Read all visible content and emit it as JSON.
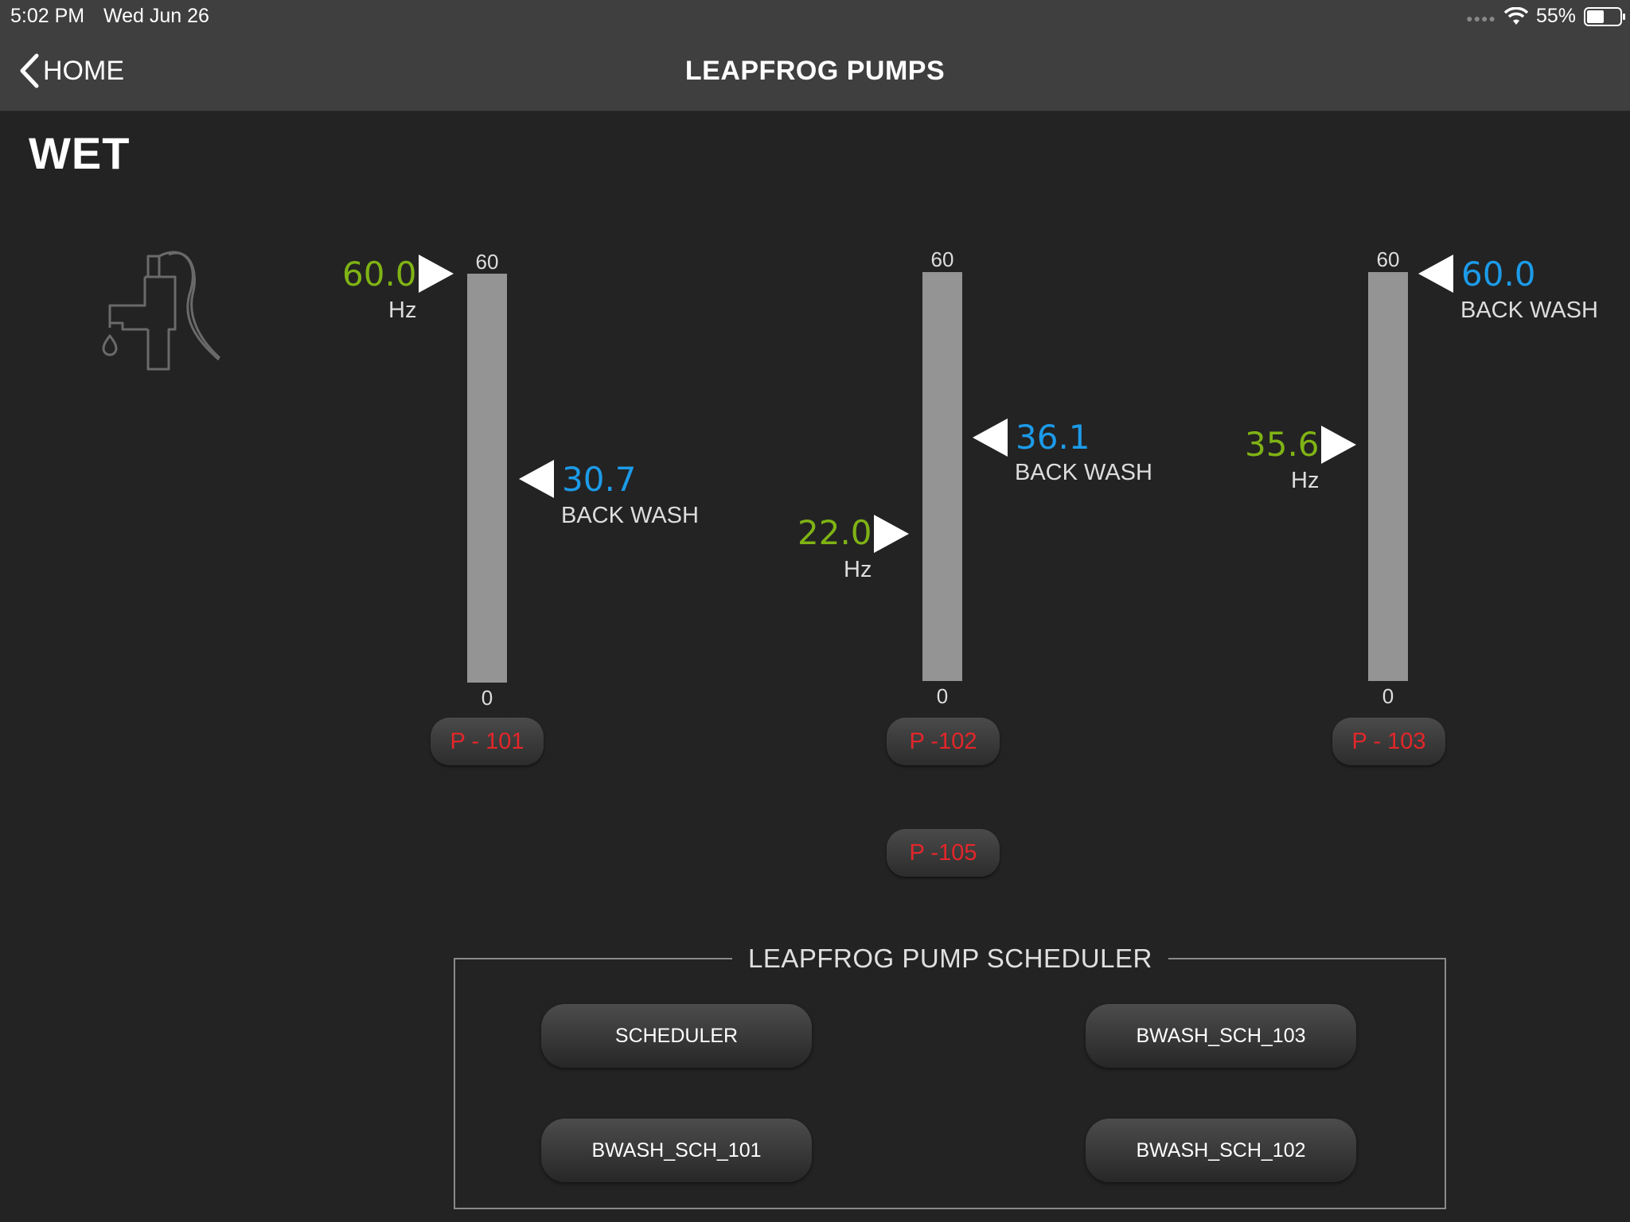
{
  "status_bar": {
    "time": "5:02 PM",
    "date": "Wed Jun 26",
    "battery": "55%",
    "battery_level": 0.55
  },
  "nav": {
    "back_label": "HOME",
    "title": "LEAPFROG PUMPS"
  },
  "section_title": "WET",
  "gauges": [
    {
      "max_label": "60",
      "min_label": "0",
      "speed_value": "60.0",
      "speed_unit": "Hz",
      "setpoint_value": "30.7",
      "setpoint_label": "BACK WASH",
      "pump_label": "P - 101"
    },
    {
      "max_label": "60",
      "min_label": "0",
      "speed_value": "22.0",
      "speed_unit": "Hz",
      "setpoint_value": "36.1",
      "setpoint_label": "BACK WASH",
      "pump_label": "P -102"
    },
    {
      "max_label": "60",
      "min_label": "0",
      "speed_value": "35.6",
      "speed_unit": "Hz",
      "setpoint_value": "60.0",
      "setpoint_label": "BACK WASH",
      "pump_label": "P - 103"
    }
  ],
  "extra_pump": {
    "label": "P -105"
  },
  "scheduler": {
    "title": "LEAPFROG PUMP SCHEDULER",
    "buttons": [
      "SCHEDULER",
      "BWASH_SCH_103",
      "BWASH_SCH_101",
      "BWASH_SCH_102"
    ]
  },
  "colors": {
    "speed": "#7fb314",
    "setpoint": "#1c9be9",
    "pump_label": "#e4262a",
    "bar": "#949494",
    "background": "#232323",
    "header": "#3f3f3f"
  },
  "icons": {
    "back": "chevron-left-icon",
    "section": "hand-pump-icon",
    "wifi": "wifi-icon",
    "battery": "battery-icon"
  }
}
